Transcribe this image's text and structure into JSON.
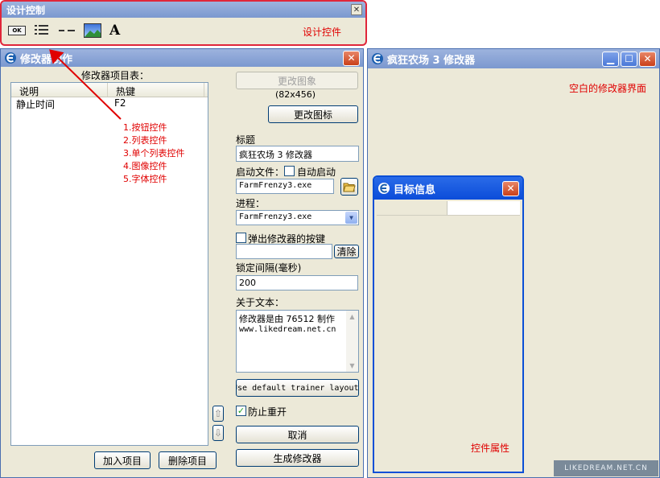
{
  "design_window": {
    "title": "设计控制",
    "label": "设计控件",
    "tools": {
      "button_tool": "OK",
      "font_tool": "A"
    }
  },
  "editor_window": {
    "title": "修改器制作",
    "list_caption": "修改器项目表：",
    "columns": [
      "说明",
      "热键"
    ],
    "rows": [
      {
        "desc": "静止时间",
        "hotkey": "F2"
      }
    ],
    "annotations": [
      "1.按钮控件",
      "2.列表控件",
      "3.单个列表控件",
      "4.图像控件",
      "5.字体控件"
    ],
    "change_image": "更改图象",
    "image_size": "(82x456)",
    "change_icon": "更改图标",
    "title_label": "标题",
    "title_value": "疯狂农场 3 修改器",
    "start_file_label": "启动文件：",
    "autostart_label": "自动启动",
    "start_file_value": "FarmFrenzy3.exe",
    "process_label": "进程：",
    "process_value": "FarmFrenzy3.exe",
    "popup_hotkey_label": "弹出修改器的按键",
    "clear_button": "清除",
    "lock_interval_label": "锁定间隔(毫秒)",
    "lock_interval_value": "200",
    "about_label": "关于文本：",
    "about_text_line1": "修改器是由 76512 制作",
    "about_text_line2": "www.likedream.net.cn",
    "layout_button": "Use default trainer layout",
    "prevent_reopen_label": "防止重开",
    "cancel_button": "取消",
    "generate_button": "生成修改器",
    "add_item_button": "加入项目",
    "delete_item_button": "删除项目",
    "move_up": "⇧",
    "move_down": "⇩"
  },
  "trainer_window": {
    "title": "疯狂农场 3 修改器",
    "blank_label": "空白的修改器界面"
  },
  "target_window": {
    "title": "目标信息",
    "properties_label": "控件属性"
  },
  "watermark": "LIKEDREAM.NET.CN",
  "colors": {
    "accent_red": "#e00000",
    "title_active": "#0b4cd9",
    "title_inactive": "#7b98cf",
    "panel": "#ece9d8"
  }
}
